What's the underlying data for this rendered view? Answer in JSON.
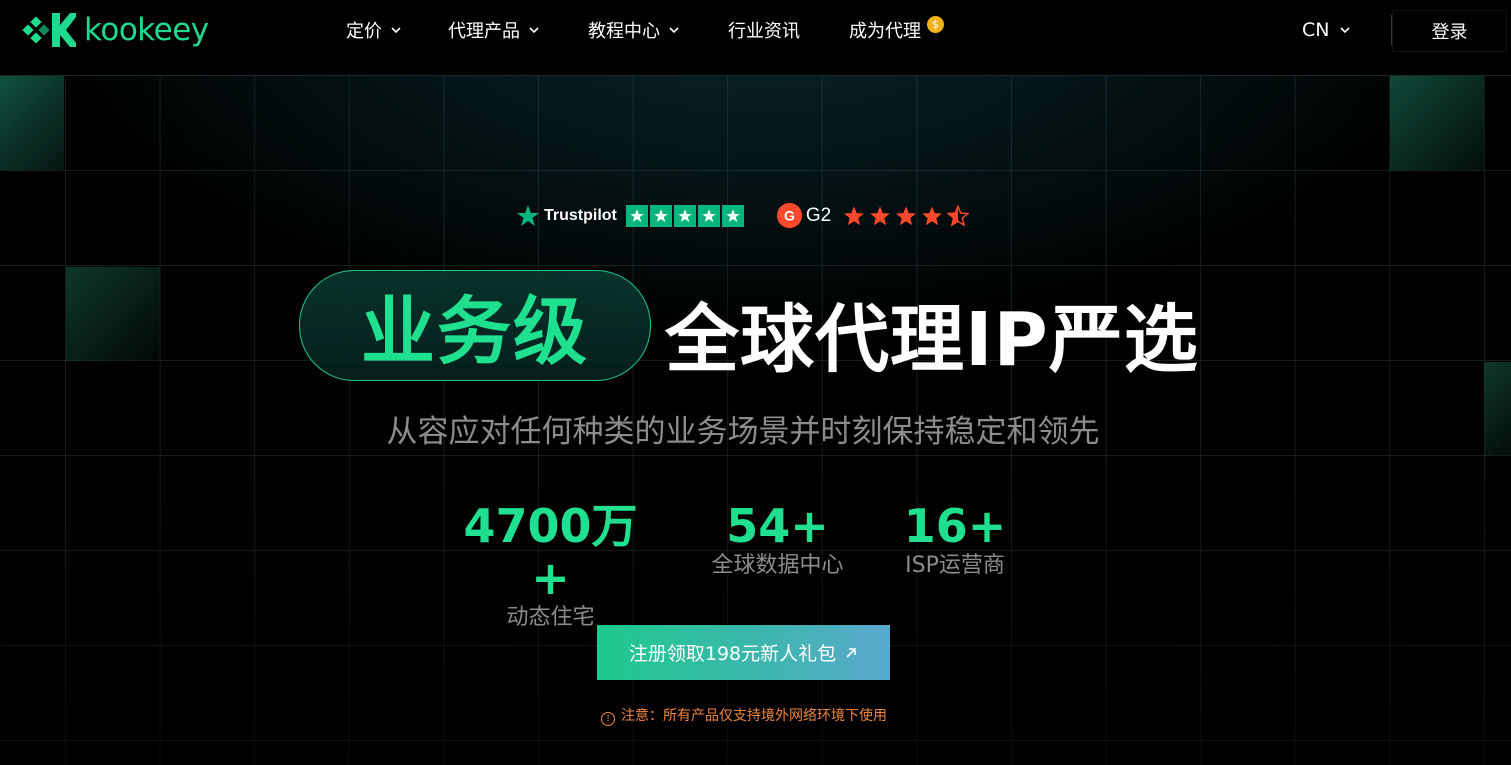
{
  "brand": {
    "name": "kookeey",
    "color": "#1ed98e"
  },
  "nav": {
    "items": [
      {
        "label": "定价",
        "has_dropdown": true
      },
      {
        "label": "代理产品",
        "has_dropdown": true
      },
      {
        "label": "教程中心",
        "has_dropdown": true
      },
      {
        "label": "行业资讯",
        "has_dropdown": false
      },
      {
        "label": "成为代理",
        "has_dropdown": false,
        "badge_icon": "coin-icon"
      }
    ],
    "language": "CN",
    "login_label": "登录"
  },
  "ratings": {
    "trustpilot_label": "Trustpilot",
    "trustpilot_stars": 5,
    "g2_label": "G2",
    "g2_stars": 4.5
  },
  "hero": {
    "highlight": "业务级",
    "title": "全球代理IP严选",
    "subtitle": "从容应对任何种类的业务场景并时刻保持稳定和领先"
  },
  "stats": [
    {
      "value": "4700万+",
      "label": "动态住宅"
    },
    {
      "value": "54+",
      "label": "全球数据中心"
    },
    {
      "value": "16+",
      "label": "ISP运营商"
    }
  ],
  "cta": {
    "label": "注册领取198元新人礼包"
  },
  "notice": {
    "text": "注意：所有产品仅支持境外网络环境下使用"
  },
  "colors": {
    "accent": "#1ee08f",
    "trustpilot_green": "#00b67a",
    "g2_red": "#ff492c",
    "notice_orange": "#f0873a",
    "coin_gold": "#f2b11d"
  }
}
